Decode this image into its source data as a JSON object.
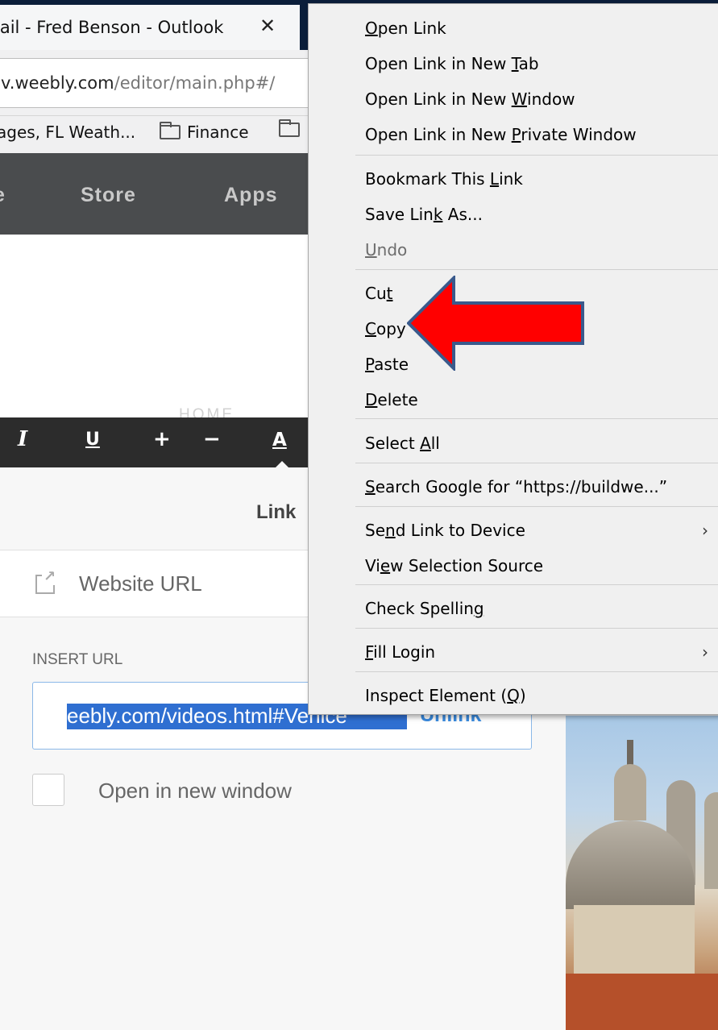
{
  "browser": {
    "tab_title": "lail - Fred Benson - Outlook",
    "tab_close": "✕",
    "url": {
      "host": "v.weebly.com",
      "path": "/editor/main.php#/"
    },
    "bookmarks": [
      "ages, FL Weath...",
      "Finance",
      ""
    ]
  },
  "editor": {
    "nav": [
      "e",
      "Store",
      "Apps"
    ],
    "home_ghost": "HOME",
    "format_toolbar": {
      "italic": "I",
      "underline": "U",
      "plus": "+",
      "minus": "−",
      "color": "A"
    }
  },
  "link_panel": {
    "title": "Link",
    "type_label": "Website URL",
    "insert_label": "INSERT URL",
    "url_value": "eebly.com/videos.html#Venice",
    "unlink_label": "Unlink",
    "new_window_label": "Open in new window"
  },
  "context_menu": {
    "items": [
      {
        "pre": "",
        "key": "O",
        "post": "pen Link"
      },
      {
        "pre": "Open Link in New ",
        "key": "T",
        "post": "ab"
      },
      {
        "pre": "Open Link in New ",
        "key": "W",
        "post": "indow"
      },
      {
        "pre": "Open Link in New ",
        "key": "P",
        "post": "rivate Window"
      },
      {
        "pre": "Bookmark This ",
        "key": "L",
        "post": "ink"
      },
      {
        "pre": "Save Lin",
        "key": "k",
        "post": " As..."
      },
      {
        "pre": "",
        "key": "U",
        "post": "ndo"
      },
      {
        "pre": "Cu",
        "key": "t",
        "post": ""
      },
      {
        "pre": "",
        "key": "C",
        "post": "opy"
      },
      {
        "pre": "",
        "key": "P",
        "post": "aste"
      },
      {
        "pre": "",
        "key": "D",
        "post": "elete"
      },
      {
        "pre": "Select ",
        "key": "A",
        "post": "ll"
      },
      {
        "pre": "",
        "key": "S",
        "post": "earch Google for “https://buildwe...”"
      },
      {
        "pre": "Se",
        "key": "n",
        "post": "d Link to Device"
      },
      {
        "pre": "Vi",
        "key": "e",
        "post": "w Selection Source"
      },
      {
        "pre": "Check Spellin",
        "key": "g",
        "post": ""
      },
      {
        "pre": "",
        "key": "F",
        "post": "ill Login"
      },
      {
        "pre": "Inspect Element (",
        "key": "Q",
        "post": ")"
      }
    ],
    "submenu_arrow": "›"
  },
  "annotation": {
    "arrow_color": "#ff0000",
    "arrow_outline": "#3a5a8c"
  }
}
